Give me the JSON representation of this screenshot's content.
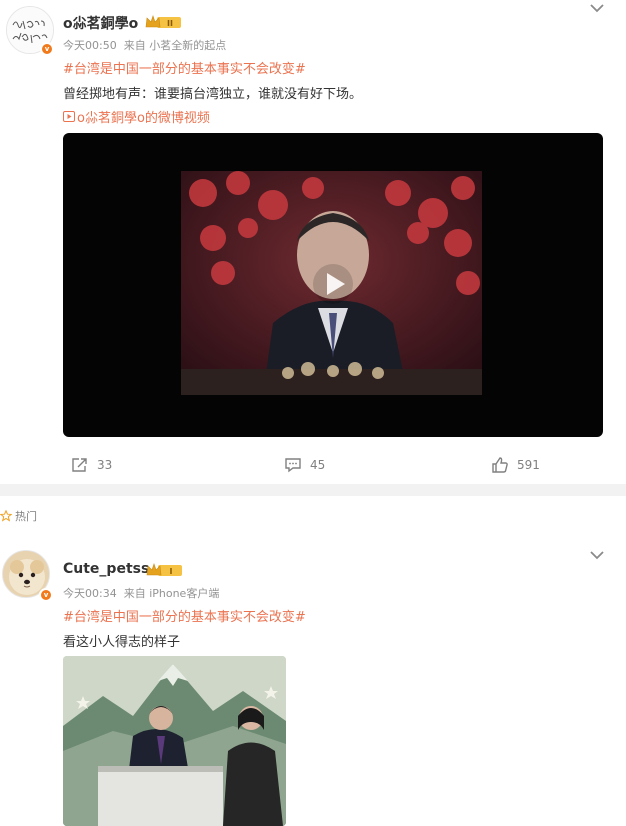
{
  "post1": {
    "username": "o尛茗銅學o",
    "time": "今天00:50",
    "source": "来自 小茗全新的起点",
    "topic": "#台湾是中国一部分的基本事实不会改变#",
    "text": "曾经掷地有声：谁要搞台湾独立，谁就没有好下场。",
    "video_link": "o尛茗銅學o的微博视频",
    "avatar_signature": "很好的 为梦想冲",
    "actions": {
      "share": "33",
      "comment": "45",
      "like": "591"
    }
  },
  "section": {
    "hot_label": "热门"
  },
  "post2": {
    "username": "Cute_petss",
    "time": "今天00:34",
    "source": "来自 iPhone客户端",
    "topic": "#台湾是中国一部分的基本事实不会改变#",
    "text": "看这小人得志的样子"
  },
  "colors": {
    "accent": "#eb7350",
    "badge": "#f07a1c",
    "gold": "#f5c243",
    "gap": "#f2f2f2"
  },
  "icons": [
    "chevron-down-icon",
    "verified-icon",
    "member-crown-icon",
    "video-link-icon",
    "play-icon",
    "share-icon",
    "comment-icon",
    "like-icon",
    "hot-star-icon"
  ]
}
